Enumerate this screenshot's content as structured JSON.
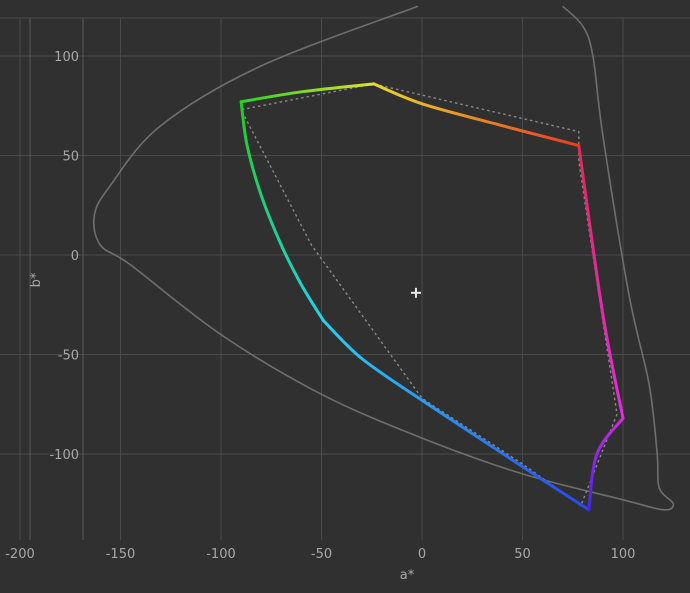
{
  "chart_data": {
    "type": "line",
    "xlabel": "a*",
    "ylabel": "b*",
    "xlim": [
      -200,
      135
    ],
    "ylim": [
      -145,
      120
    ],
    "x_ticks": [
      -200,
      -150,
      -100,
      -50,
      0,
      50,
      100
    ],
    "y_ticks": [
      -100,
      -50,
      0,
      50,
      100
    ],
    "x_tick_labels": [
      "-200",
      "-150",
      "-100",
      "-50",
      "0",
      "50",
      "100"
    ],
    "y_tick_labels": [
      "-100",
      "-50",
      "0",
      "50",
      "100"
    ],
    "grid": true,
    "white_point": [
      -3,
      -19
    ],
    "colors": {
      "background": "#303030",
      "grid": "#4a4a4a",
      "locus": "#6e6e6e",
      "reference_gamut": "#8a8a8a",
      "text": "#a8a8a8"
    },
    "spectral_locus": {
      "x": [
        -2,
        -80,
        -130,
        -155,
        -163,
        -160,
        -145,
        -100,
        -50,
        0,
        50,
        100,
        120,
        125,
        118,
        117,
        113,
        103,
        90,
        85,
        80,
        70
      ],
      "y": [
        125,
        95,
        65,
        35,
        20,
        5,
        -5,
        -40,
        -70,
        -92,
        -110,
        -123,
        -128,
        -125,
        -117,
        -100,
        -65,
        -20,
        60,
        100,
        115,
        125
      ]
    },
    "reference_gamut": {
      "x": [
        -24,
        -90,
        -55,
        0,
        50,
        79,
        97,
        78,
        78,
        -24
      ],
      "y": [
        86,
        73,
        5,
        -72,
        -105,
        -126,
        -80,
        47,
        62,
        86
      ]
    },
    "gamut_edges": [
      {
        "x": [
          -90,
          -87,
          -80,
          -70,
          -60,
          -49
        ],
        "y": [
          77,
          55,
          30,
          5,
          -15,
          -33
        ],
        "color_start": "#22cc22",
        "color_end": "#22d2e8"
      },
      {
        "x": [
          -49,
          -30,
          0,
          30,
          60,
          83
        ],
        "y": [
          -33,
          -52,
          -73,
          -93,
          -113,
          -128
        ],
        "color_start": "#2ad0f0",
        "color_end": "#2846ee"
      },
      {
        "x": [
          83,
          87,
          100
        ],
        "y": [
          -128,
          -100,
          -82
        ],
        "color_start": "#4025ee",
        "color_end": "#d42adc"
      },
      {
        "x": [
          100,
          90,
          78
        ],
        "y": [
          -82,
          -30,
          55
        ],
        "color_start": "#e62ae0",
        "color_end": "#e02a5a"
      },
      {
        "x": [
          78,
          40,
          0,
          -24
        ],
        "y": [
          55,
          65,
          76,
          86
        ],
        "color_start": "#e83a20",
        "color_end": "#e8d830"
      },
      {
        "x": [
          -24,
          -60,
          -90
        ],
        "y": [
          86,
          82,
          77
        ],
        "color_start": "#e0e22a",
        "color_end": "#28d228"
      }
    ]
  }
}
